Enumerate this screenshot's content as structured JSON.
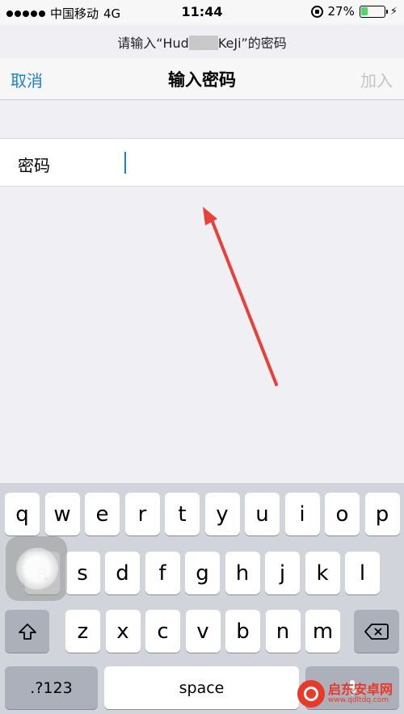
{
  "status_bar": {
    "carrier": "中国移动",
    "network": "4G",
    "time": "11:44",
    "battery_text": "27%",
    "battery_level": 0.27,
    "battery_color": "#4cd964"
  },
  "prompt": {
    "prefix": "请输入“Hud",
    "suffix": "KeJi”的密码"
  },
  "nav": {
    "cancel_label": "取消",
    "title": "输入密码",
    "join_label": "加入"
  },
  "field": {
    "label": "密码",
    "value": ""
  },
  "keyboard": {
    "row1": [
      "q",
      "w",
      "e",
      "r",
      "t",
      "y",
      "u",
      "i",
      "o",
      "p"
    ],
    "row2": [
      "a",
      "s",
      "d",
      "f",
      "g",
      "h",
      "j",
      "k",
      "l"
    ],
    "row3": [
      "z",
      "x",
      "c",
      "v",
      "b",
      "n",
      "m"
    ],
    "shift_icon": "shift-icon",
    "delete_icon": "backspace-icon",
    "numbers_label": ".?123",
    "space_label": "space",
    "dictation_icon": "microphone-icon",
    "pressed_key": "a"
  },
  "watermark": {
    "title": "启东安卓网",
    "url": "www.qdltdq.com"
  },
  "colors": {
    "accent": "#1a82c8",
    "annotation_arrow": "#e8403a",
    "disabled": "#c4c4c8"
  }
}
